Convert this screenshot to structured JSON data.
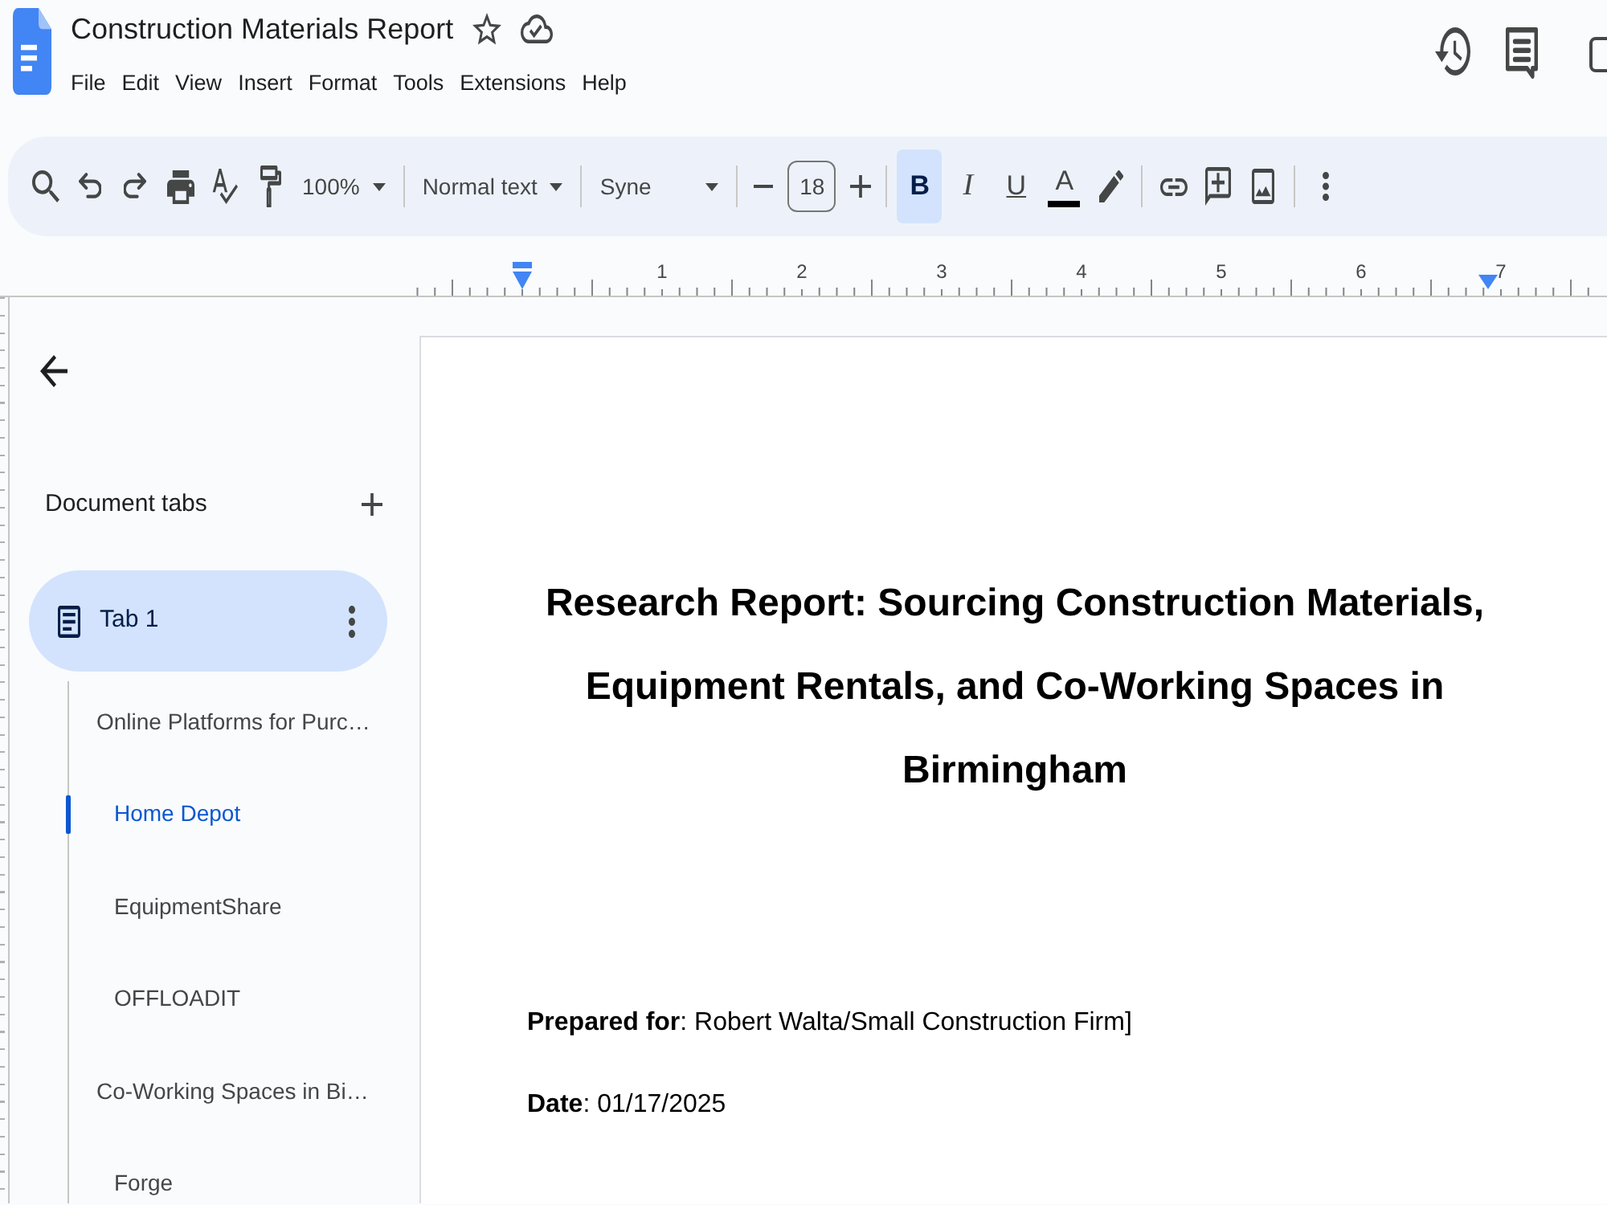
{
  "app": {
    "title": "Construction Materials Report",
    "starred": false,
    "menu": [
      "File",
      "Edit",
      "View",
      "Insert",
      "Format",
      "Tools",
      "Extensions",
      "Help"
    ]
  },
  "toolbar": {
    "zoom": "100%",
    "paragraph_style": "Normal text",
    "font": "Syne",
    "font_size": "18",
    "format_buttons": [
      {
        "kind": "bold",
        "label": "B",
        "selected": true
      },
      {
        "kind": "italic",
        "label": "I",
        "selected": false
      },
      {
        "kind": "underline",
        "label": "U",
        "selected": false
      },
      {
        "kind": "text_color",
        "label": "A",
        "selected": false,
        "color": "#000000"
      }
    ]
  },
  "ruler": {
    "numbers": [
      "1",
      "2",
      "3",
      "4",
      "5",
      "6",
      "7"
    ]
  },
  "sidebar": {
    "heading": "Document tabs",
    "tabs": [
      {
        "label": "Tab 1",
        "selected": true,
        "outline": [
          {
            "text": "Online Platforms for Purc…",
            "selected": false,
            "children": [
              {
                "text": "Home Depot",
                "selected": true
              },
              {
                "text": "EquipmentShare",
                "selected": false
              },
              {
                "text": "OFFLOADIT",
                "selected": false
              }
            ]
          },
          {
            "text": "Co-Working Spaces in Bi…",
            "selected": false,
            "children": [
              {
                "text": "Forge",
                "selected": false
              }
            ]
          }
        ]
      }
    ]
  },
  "document": {
    "title": "Research Report: Sourcing Construction Materials, Equipment Rentals, and Co-Working Spaces in Birmingham",
    "lines": [
      "**Prepared for**: Robert Walta/Small Construction Firm]",
      "**Date**: 01/17/2025"
    ]
  }
}
